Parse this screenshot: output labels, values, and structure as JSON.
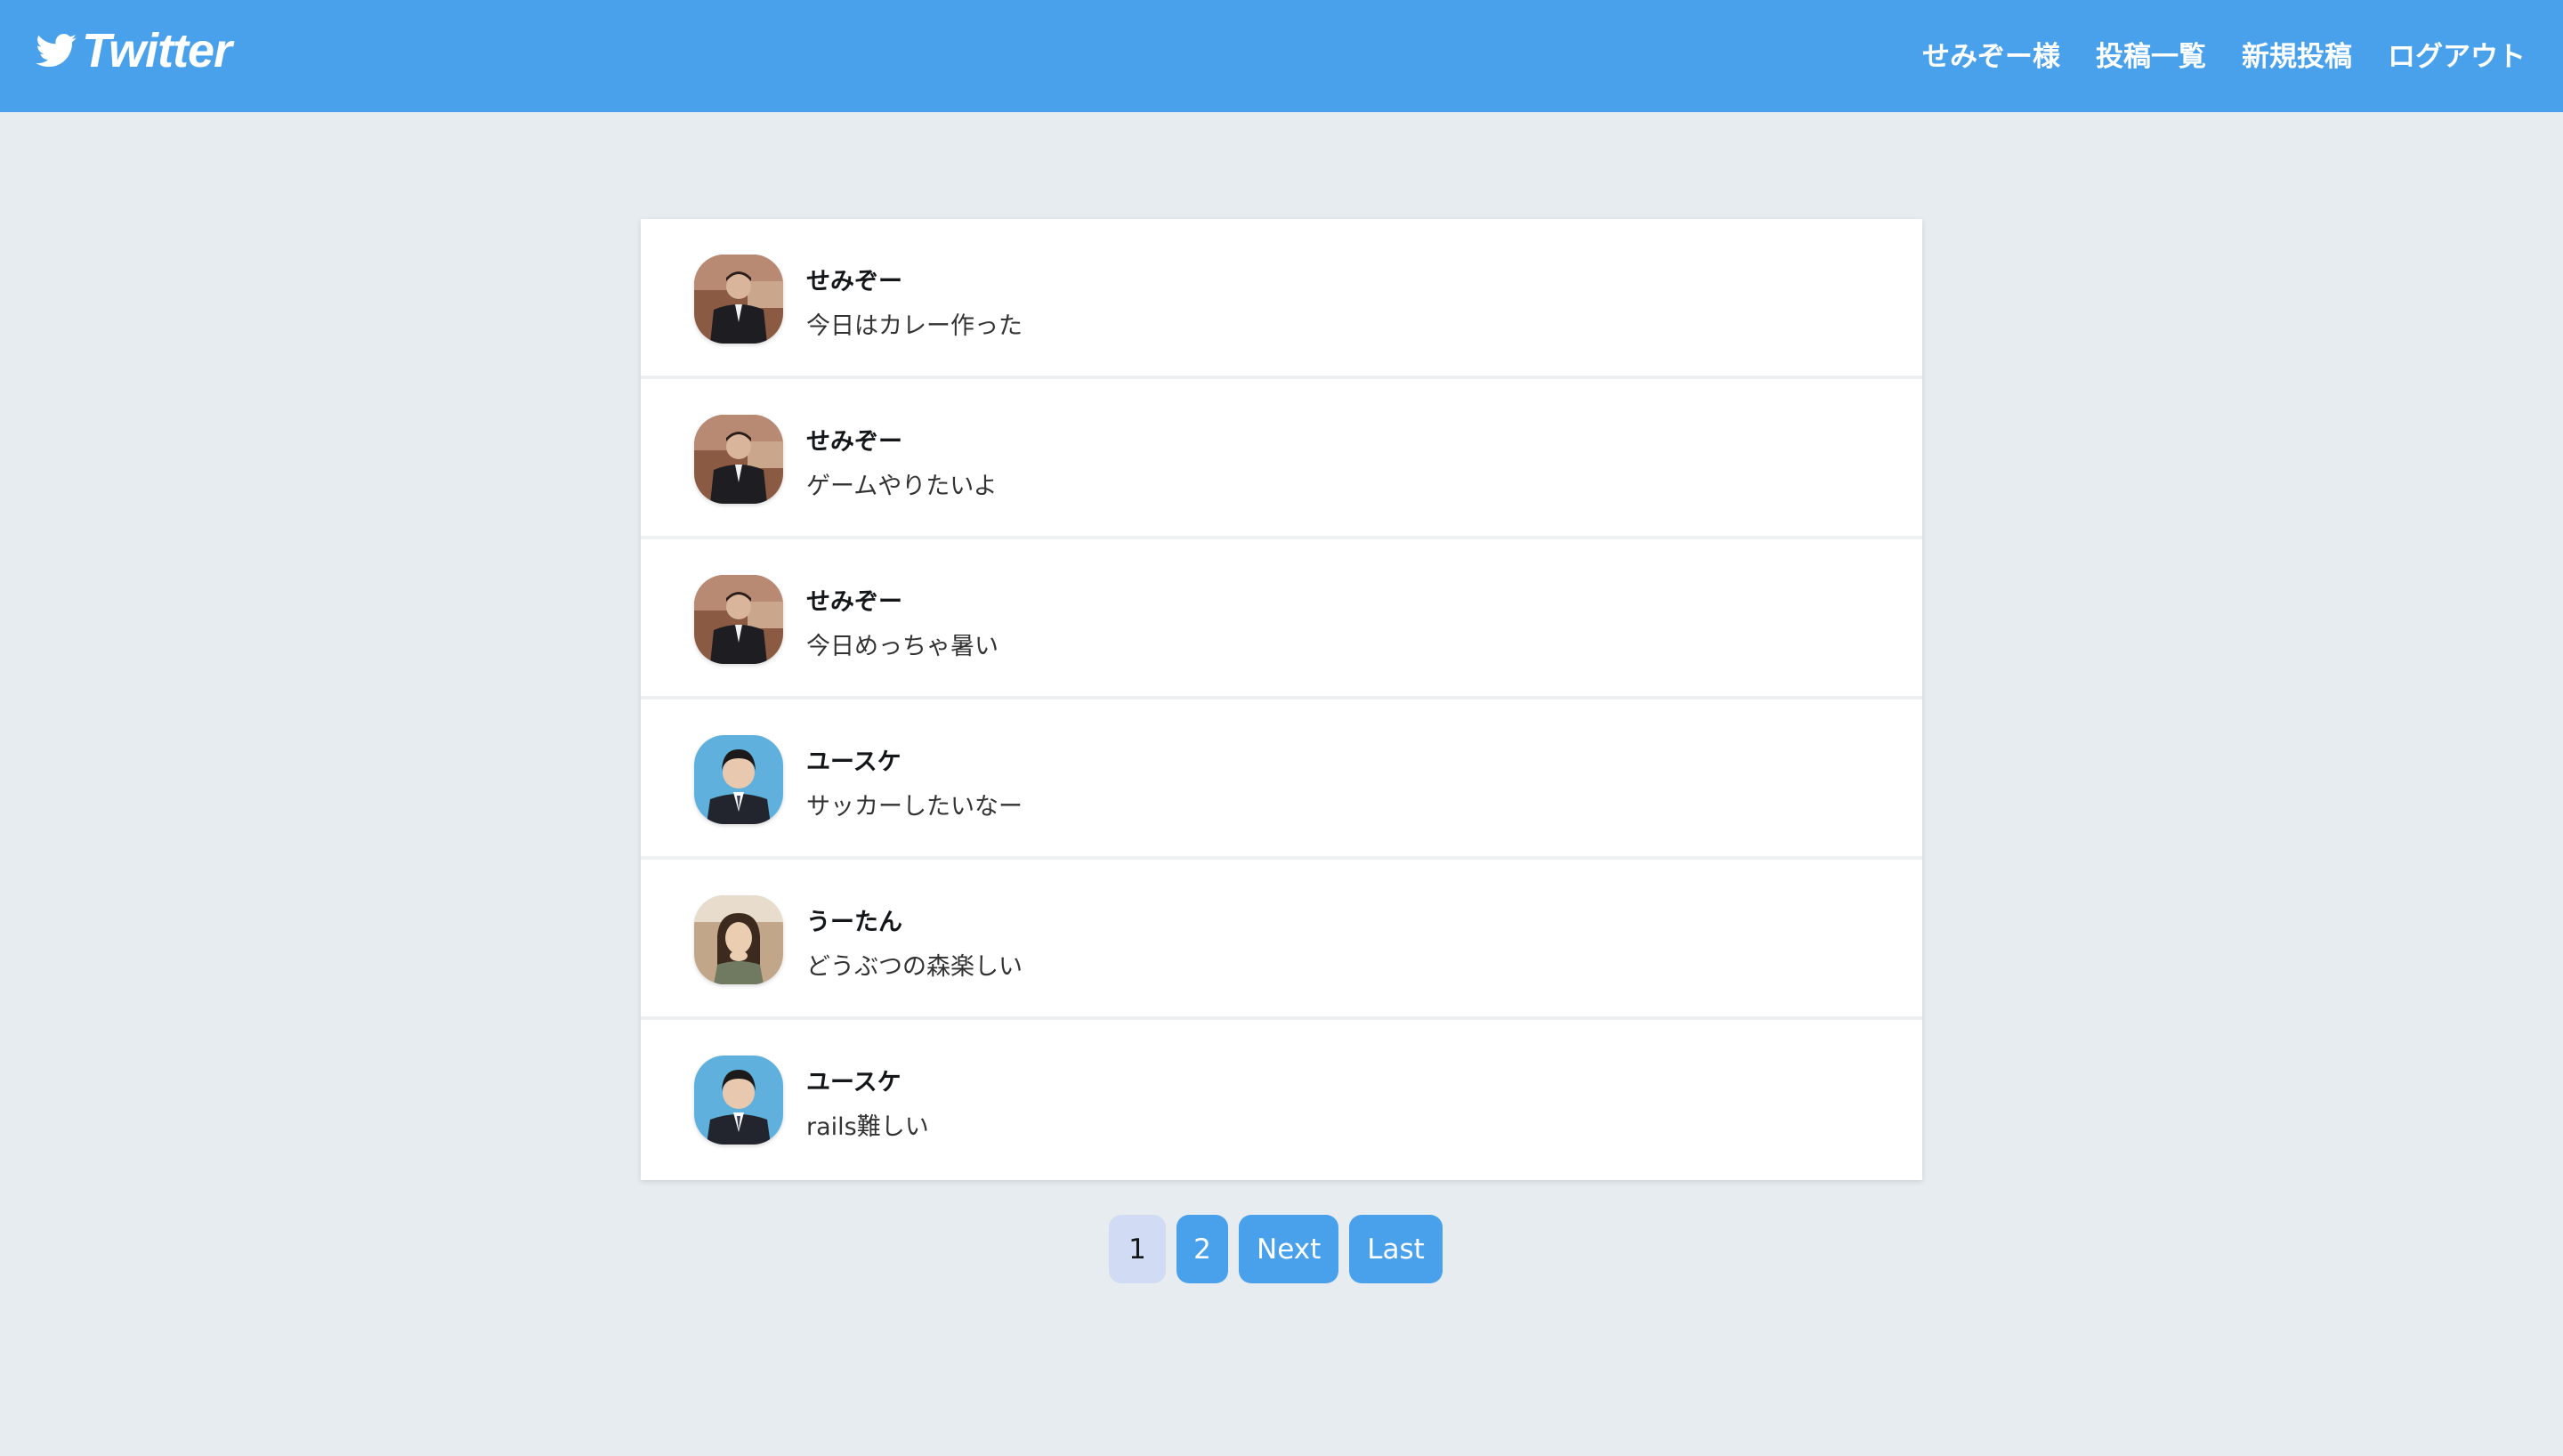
{
  "header": {
    "logo_text": "Twitter",
    "brand_color": "#4aa1eb",
    "nav": [
      {
        "label": "せみぞー様"
      },
      {
        "label": "投稿一覧"
      },
      {
        "label": "新規投稿"
      },
      {
        "label": "ログアウト"
      }
    ]
  },
  "posts": [
    {
      "name": "せみぞー",
      "text": "今日はカレー作った",
      "avatar": "user-semizo"
    },
    {
      "name": "せみぞー",
      "text": "ゲームやりたいよ",
      "avatar": "user-semizo"
    },
    {
      "name": "せみぞー",
      "text": "今日めっちゃ暑い",
      "avatar": "user-semizo"
    },
    {
      "name": "ユースケ",
      "text": "サッカーしたいなー",
      "avatar": "user-yusuke"
    },
    {
      "name": "うーたん",
      "text": "どうぶつの森楽しい",
      "avatar": "user-utan"
    },
    {
      "name": "ユースケ",
      "text": "rails難しい",
      "avatar": "user-yusuke"
    }
  ],
  "pagination": {
    "current": "1",
    "page2": "2",
    "next": "Next",
    "last": "Last"
  }
}
